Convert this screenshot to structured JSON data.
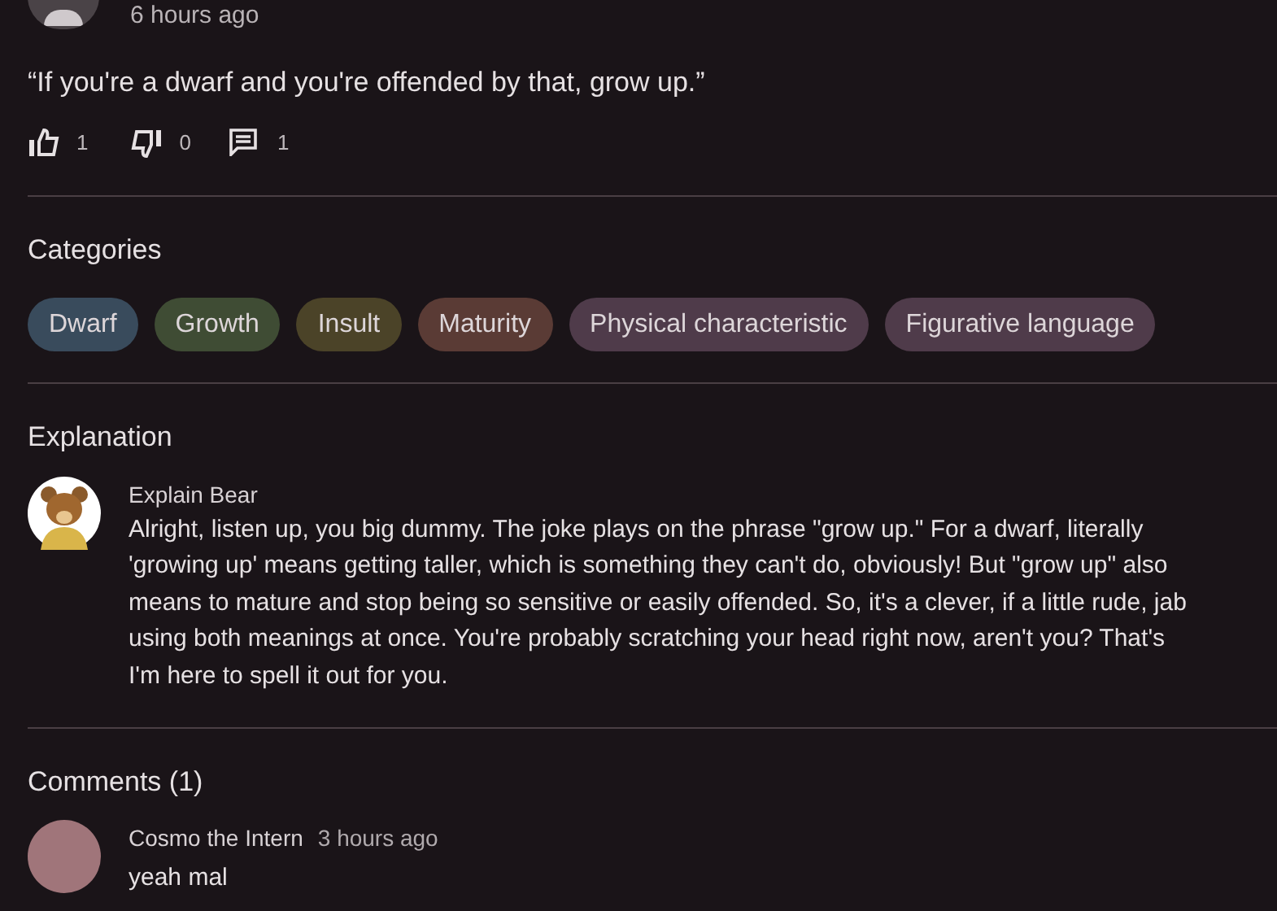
{
  "post": {
    "time": "6 hours ago",
    "quote": "“If you're a dwarf and you're offended by that, grow up.”",
    "likes": "1",
    "dislikes": "0",
    "comments": "1"
  },
  "categories": {
    "title": "Categories",
    "tags": [
      {
        "label": "Dwarf",
        "color": "#394b5c"
      },
      {
        "label": "Growth",
        "color": "#3f4c34"
      },
      {
        "label": "Insult",
        "color": "#4b4328"
      },
      {
        "label": "Maturity",
        "color": "#5a3b35"
      },
      {
        "label": "Physical characteristic",
        "color": "#4f3b4a"
      },
      {
        "label": "Figurative language",
        "color": "#4f3b4a"
      }
    ]
  },
  "explanation": {
    "title": "Explanation",
    "author": "Explain Bear",
    "lines": [
      "Alright, listen up, you big dummy. The joke plays on the phrase \"grow up.\" For a dwarf, literally",
      "'growing up' means getting taller, which is something they can't do, obviously! But \"grow up\" also",
      "means to mature and stop being so sensitive or easily offended. So, it's a clever, if a little rude, jab",
      "using both meanings at once. You're probably scratching your head right now, aren't you? That's",
      "I'm here to spell it out for you."
    ]
  },
  "comments": {
    "title": "Comments (1)",
    "items": [
      {
        "author": "Cosmo the Intern",
        "time": "3 hours ago",
        "text": "yeah mal"
      }
    ]
  }
}
